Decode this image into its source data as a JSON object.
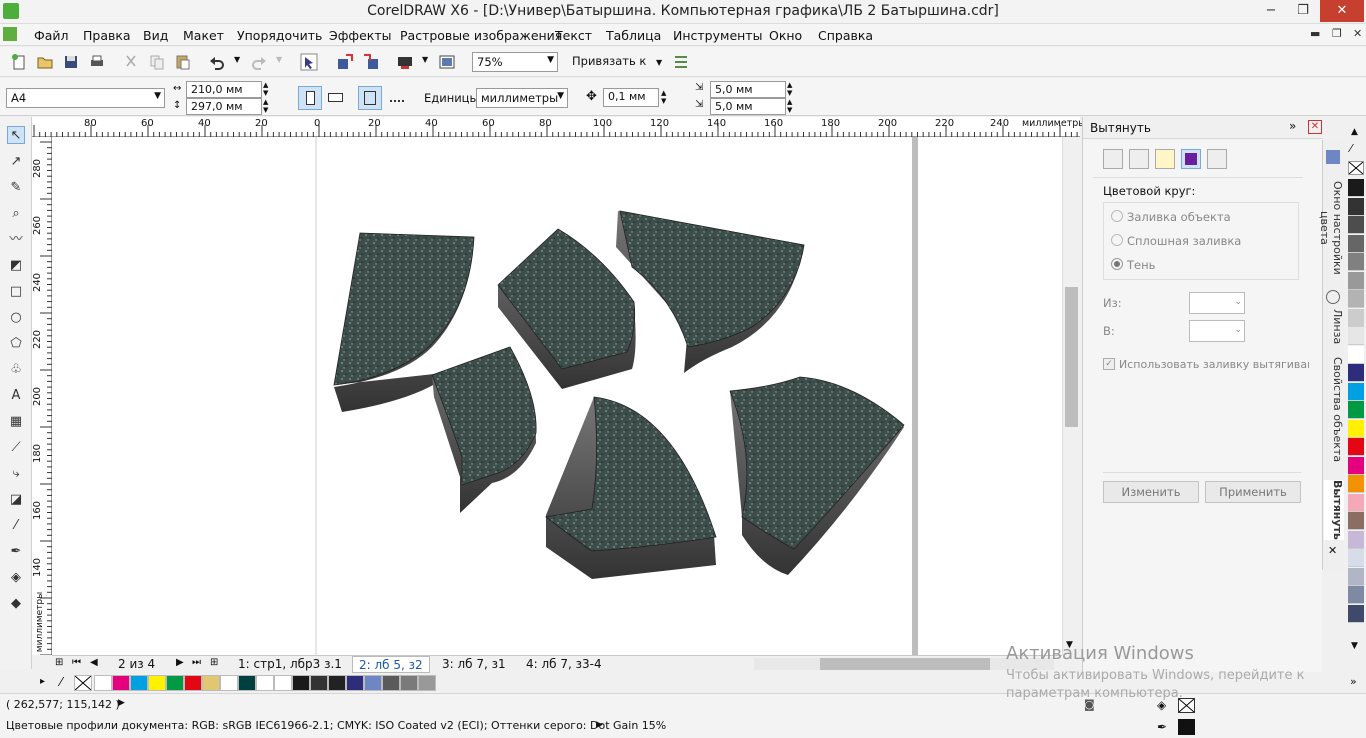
{
  "window": {
    "title": "CorelDRAW X6 - [D:\\Универ\\Батыршина. Компьютерная графика\\ЛБ 2 Батыршина.cdr]",
    "minimize": "−",
    "restore": "❐",
    "close": "✕"
  },
  "menu": [
    "Файл",
    "Правка",
    "Вид",
    "Макет",
    "Упорядочить",
    "Эффекты",
    "Растровые изображения",
    "Текст",
    "Таблица",
    "Инструменты",
    "Окно",
    "Справка"
  ],
  "toolbar": {
    "zoom": "75%",
    "snap": "Привязать к"
  },
  "property_bar": {
    "page_size": "A4",
    "width": "210,0 мм",
    "height": "297,0 мм",
    "units_label": "Единицы:",
    "units_value": "миллиметры",
    "nudge": "0,1 мм",
    "dup_x": "5,0 мм",
    "dup_y": "5,0 мм"
  },
  "rulers": {
    "h_labels": [
      "80",
      "60",
      "40",
      "20",
      "0",
      "20",
      "40",
      "60",
      "80",
      "100",
      "120",
      "140",
      "160",
      "180",
      "200",
      "220",
      "240"
    ],
    "h_unit": "миллиметры",
    "v_labels": [
      "280",
      "260",
      "240",
      "220",
      "200",
      "180",
      "160",
      "140"
    ],
    "v_unit": "миллиметры"
  },
  "page_nav": {
    "counter": "2 из 4",
    "tabs": [
      "1: стр1, лбр3 з.1",
      "2: лб 5, з2",
      "3: лб 7, з1",
      "4: лб 7, з3-4"
    ]
  },
  "docker": {
    "title": "Вытянуть",
    "color_wheel_label": "Цветовой круг:",
    "options": [
      "Заливка объекта",
      "Сплошная заливка",
      "Тень"
    ],
    "selected_option": "Тень",
    "from_label": "Из:",
    "to_label": "В:",
    "checkbox_label": "Использовать заливку вытягивания для",
    "edit_button": "Изменить",
    "apply_button": "Применить"
  },
  "side_tabs": [
    "Окно настройки цвета",
    "Линза",
    "Свойства объекта",
    "Вытянуть"
  ],
  "status": {
    "coords": "( 262,577; 115,142 )",
    "profiles": "Цветовые профили документа: RGB: sRGB IEC61966-2.1; CMYK: ISO Coated v2 (ECI); Оттенки серого: Dot Gain 15%"
  },
  "watermark": {
    "title": "Активация Windows",
    "text": "Чтобы активировать Windows, перейдите к параметрам компьютера."
  },
  "palette_bottom": [
    "#ffffff",
    "#e5007e",
    "#00a0e3",
    "#fff100",
    "#009a44",
    "#e30613",
    "#e2c772",
    "#ffffff",
    "#003f3f",
    "#ffffff",
    "#ffffff",
    "#1a1a1a",
    "#333333",
    "#222222",
    "#2e2d7b",
    "#6f86c4",
    "#5a5a5a",
    "#7a7a7a",
    "#999999"
  ],
  "palette_right": [
    "#1a1a1a",
    "#333333",
    "#4d4d4d",
    "#666666",
    "#808080",
    "#999999",
    "#b3b3b3",
    "#cccccc",
    "#e6e6e6",
    "#ffffff",
    "#2e2d7b",
    "#00a0e3",
    "#009a44",
    "#fff100",
    "#e30613",
    "#e5007e",
    "#f39200",
    "#f5a9b8",
    "#8c6d62",
    "#c8b8d8",
    "#d7dde8",
    "#b0b6c5",
    "#7e8aa3",
    "#3f4a6b"
  ]
}
